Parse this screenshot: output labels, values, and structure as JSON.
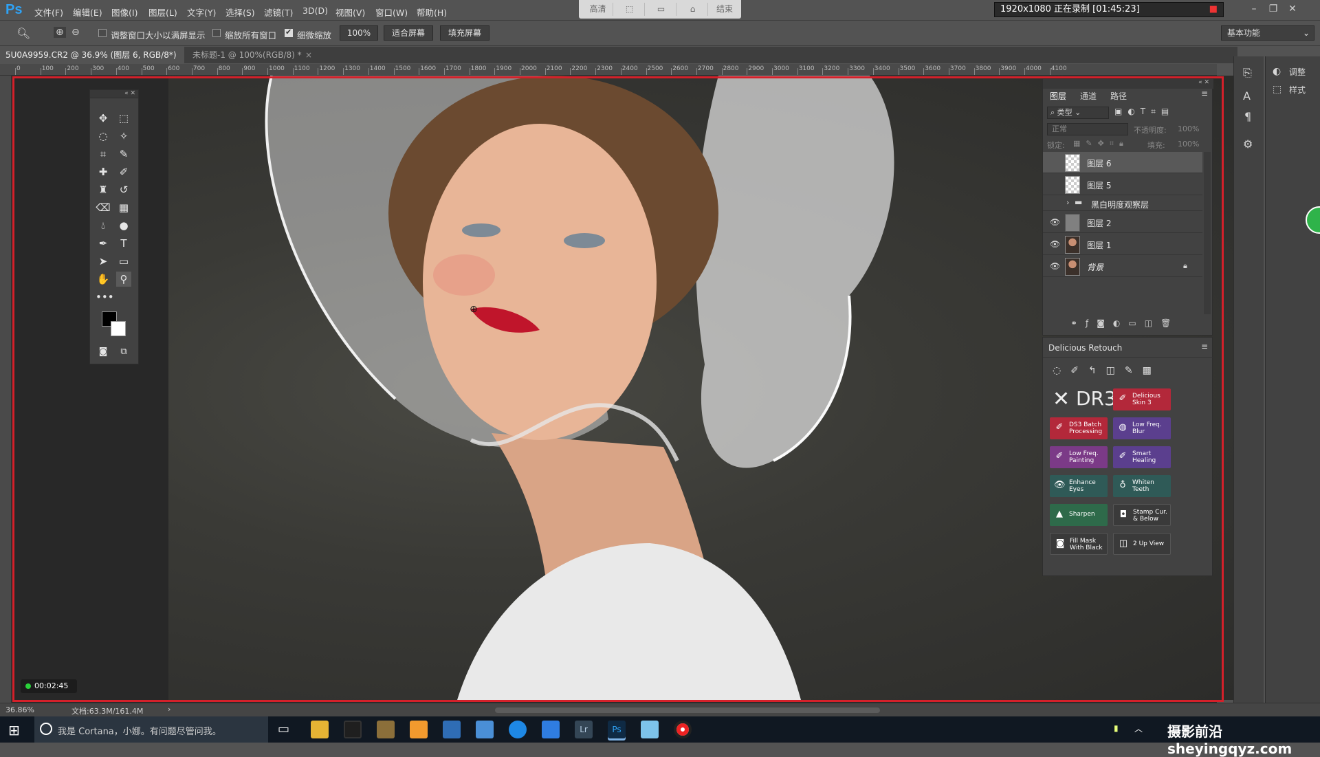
{
  "app": {
    "logo": "Ps",
    "brand_color": "#2fa3f6",
    "accent_red": "#d4202a"
  },
  "menu": [
    "文件(F)",
    "编辑(E)",
    "图像(I)",
    "图层(L)",
    "文字(Y)",
    "选择(S)",
    "滤镜(T)",
    "3D(D)",
    "视图(V)",
    "窗口(W)",
    "帮助(H)"
  ],
  "recorder_toolbar": [
    "高清",
    "",
    "",
    "",
    "结束"
  ],
  "recorder_status": "1920x1080  正在录制 [01:45:23]",
  "options": {
    "resize_windows": "调整窗口大小以满屏显示",
    "zoom_all": "缩放所有窗口",
    "scrubby_zoom": "细微缩放",
    "zoom_value": "100%",
    "fit_screen": "适合屏幕",
    "fill_screen": "填充屏幕",
    "workspace": "基本功能"
  },
  "tabs": [
    {
      "label": "5U0A9959.CR2 @ 36.9% (图层 6, RGB/8*) *"
    },
    {
      "label": "未标题-1 @ 100%(RGB/8) *"
    }
  ],
  "ruler_labels": [
    "0",
    "100",
    "200",
    "300",
    "400",
    "500",
    "600",
    "700",
    "800",
    "900",
    "1000",
    "1100",
    "1200",
    "1300",
    "1400",
    "1500",
    "1600",
    "1700",
    "1800",
    "1900",
    "2000",
    "2100",
    "2200",
    "2300",
    "2400",
    "2500",
    "2600",
    "2700",
    "2800",
    "2900",
    "3000",
    "3100",
    "3200",
    "3300",
    "3400",
    "3500",
    "3600",
    "3700",
    "3800",
    "3900",
    "4000",
    "4100"
  ],
  "layers_panel": {
    "tabs": [
      "图层",
      "通道",
      "路径"
    ],
    "filter": "类型",
    "blend_mode": "正常",
    "opacity_label": "不透明度:",
    "opacity": "100%",
    "lock_label": "锁定:",
    "fill_label": "填充:",
    "fill": "100%",
    "layers": [
      {
        "name": "图层 6",
        "visible": false,
        "thumb": "transparent",
        "selected": true
      },
      {
        "name": "图层 5",
        "visible": false,
        "thumb": "transparent"
      },
      {
        "name": "黑白明度观察层",
        "visible": false,
        "thumb": "folder"
      },
      {
        "name": "图层 2",
        "visible": true,
        "thumb": "gray"
      },
      {
        "name": "图层 1",
        "visible": true,
        "thumb": "portrait"
      },
      {
        "name": "背景",
        "visible": true,
        "thumb": "portrait",
        "locked": true
      }
    ]
  },
  "dr_panel": {
    "title": "Delicious Retouch",
    "logo": "DR3",
    "buttons": [
      {
        "label": "Delicious Skin 3",
        "color": "red",
        "icon": "brush-icon"
      },
      {
        "label": "DS3 Batch Processing",
        "color": "red",
        "icon": "brush-icon"
      },
      {
        "label": "Low Freq. Blur",
        "color": "violet",
        "icon": "blur-icon"
      },
      {
        "label": "Low Freq. Painting",
        "color": "purple",
        "icon": "brush-icon"
      },
      {
        "label": "Smart Healing",
        "color": "violet",
        "icon": "brush-icon"
      },
      {
        "label": "Enhance Eyes",
        "color": "teal",
        "icon": "eye-icon"
      },
      {
        "label": "Whiten Teeth",
        "color": "teal",
        "icon": "tooth-icon"
      },
      {
        "label": "Sharpen",
        "color": "green",
        "icon": "triangle-icon"
      },
      {
        "label": "Stamp Cur. & Below",
        "color": "gray",
        "icon": "stamp-icon"
      },
      {
        "label": "Fill Mask With Black",
        "color": "gray",
        "icon": "mask-icon"
      },
      {
        "label": "2 Up View",
        "color": "gray",
        "icon": "split-icon"
      }
    ]
  },
  "side_dock": {
    "adjust": "调整",
    "styles": "样式"
  },
  "status": {
    "zoom": "36.86%",
    "doc": "文档:63.3M/161.4M"
  },
  "timer": "00:02:45",
  "taskbar": {
    "cortana": "我是 Cortana，小娜。有问题尽管问我。",
    "watermark": "摄影前沿sheyingqyz.com"
  }
}
